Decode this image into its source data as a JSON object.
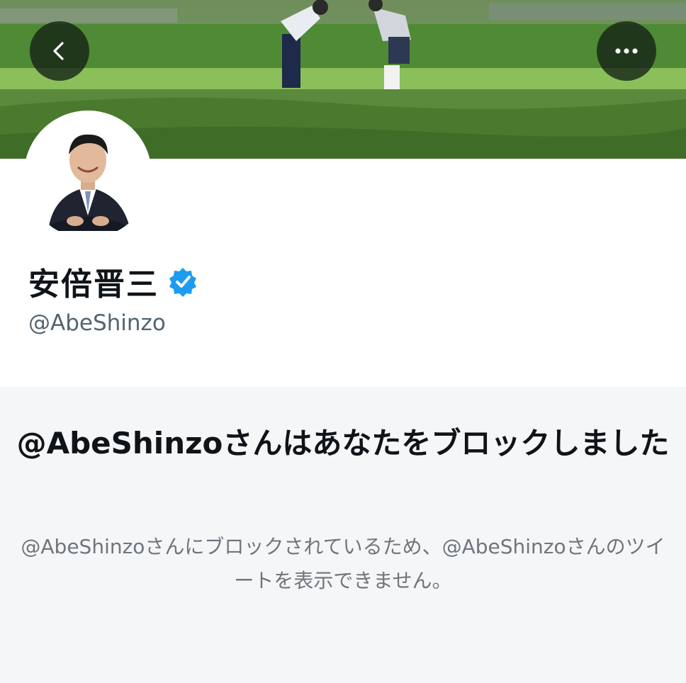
{
  "profile": {
    "display_name": "安倍晋三",
    "verified": true,
    "handle": "@AbeShinzo"
  },
  "nav": {
    "back_icon": "chevron-left-icon",
    "more_icon": "more-horizontal-icon"
  },
  "blocked": {
    "title": "@AbeShinzoさんはあなたをブロックしました",
    "message": "@AbeShinzoさんにブロックされているため、@AbeShinzoさんのツイートを表示できません。"
  },
  "colors": {
    "verified_badge": "#1d9bf0",
    "panel_background": "#f5f6f7",
    "secondary_text": "#6e767d"
  }
}
